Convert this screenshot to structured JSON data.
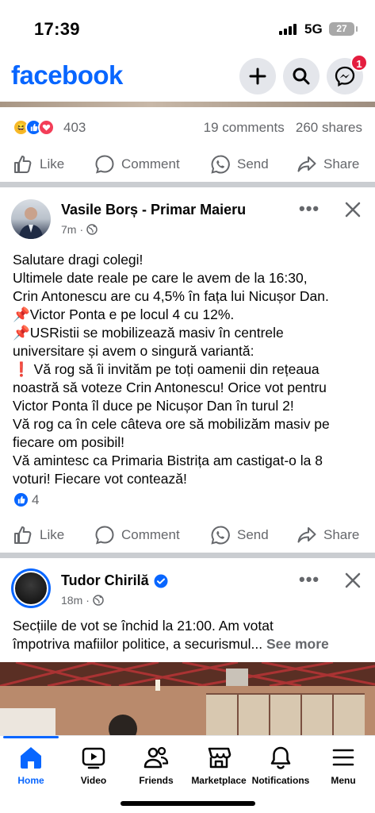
{
  "status": {
    "time": "17:39",
    "network": "5G",
    "battery": "27"
  },
  "header": {
    "logo": "facebook",
    "messenger_badge": "1"
  },
  "post1_footer": {
    "reaction_count": "403",
    "comments": "19 comments",
    "shares": "260 shares"
  },
  "actions": {
    "like": "Like",
    "comment": "Comment",
    "send": "Send",
    "share": "Share"
  },
  "post2": {
    "author": "Vasile Borș - Primar Maieru",
    "time": "7m",
    "lines": [
      "Salutare dragi colegi!",
      "Ultimele date reale pe care le avem de la 16:30,",
      "Crin Antonescu are cu 4,5% în fața lui Nicușor Dan.",
      "📌Victor Ponta e pe locul 4 cu 12%.",
      "📌USRistii se mobilizează masiv în centrele",
      "universitare și avem o singură variantă:",
      "❗ Vă rog să îi invităm pe toți oamenii din rețeaua",
      "noastră să voteze Crin Antonescu! Orice vot pentru",
      "Victor Ponta îl duce pe Nicușor Dan în turul 2!",
      "Vă rog ca în cele câteva ore să mobilizăm masiv pe",
      "fiecare om posibil!",
      "Vă amintesc ca Primaria Bistrița am castigat-o la 8",
      "voturi! Fiecare vot contează!"
    ],
    "reaction_count": "4"
  },
  "post3": {
    "author": "Tudor Chirilă",
    "time": "18m",
    "text": "Secțiile de vot se închid la 21:00. Am votat împotriva mafiilor politice, a securismul...",
    "line1": "Secțiile de vot se închid la 21:00. Am votat",
    "line2": "împotriva mafiilor politice, a securismul...",
    "see_more": "See more"
  },
  "tabs": [
    "Home",
    "Video",
    "Friends",
    "Marketplace",
    "Notifications",
    "Menu"
  ],
  "colors": {
    "brand": "#0866ff",
    "badge": "#e41e3f",
    "secondary_text": "#65676b"
  }
}
